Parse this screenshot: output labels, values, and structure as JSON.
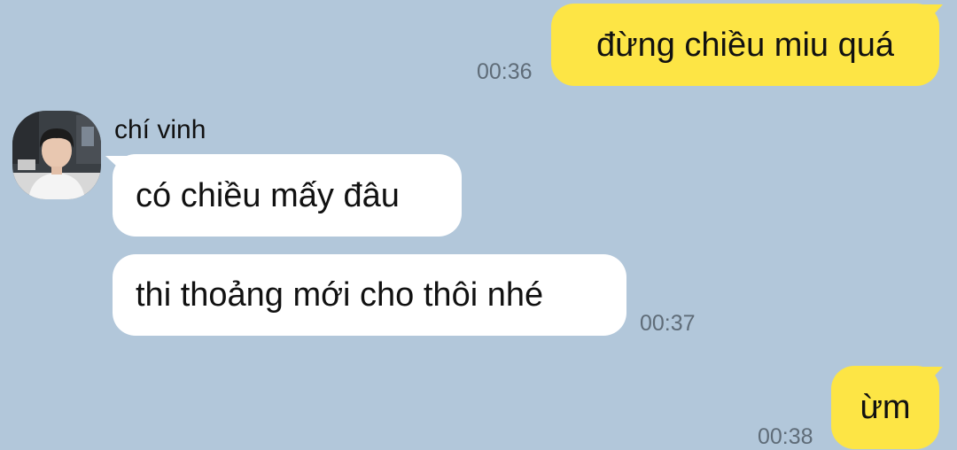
{
  "chat": {
    "messages": [
      {
        "sender": "me",
        "text": "đừng chiều miu quá",
        "time": "00:36"
      },
      {
        "sender": "them",
        "name": "chí vinh",
        "text": "có chiều mấy đâu"
      },
      {
        "sender": "them",
        "text": "thi thoảng mới cho thôi nhé",
        "time": "00:37"
      },
      {
        "sender": "me",
        "text": "ừm",
        "time": "00:38"
      }
    ]
  },
  "colors": {
    "background": "#b2c7da",
    "outgoing_bubble": "#fde545",
    "incoming_bubble": "#ffffff",
    "timestamp": "#5f6c78"
  },
  "icons": {
    "avatar": "user-avatar-photo"
  }
}
